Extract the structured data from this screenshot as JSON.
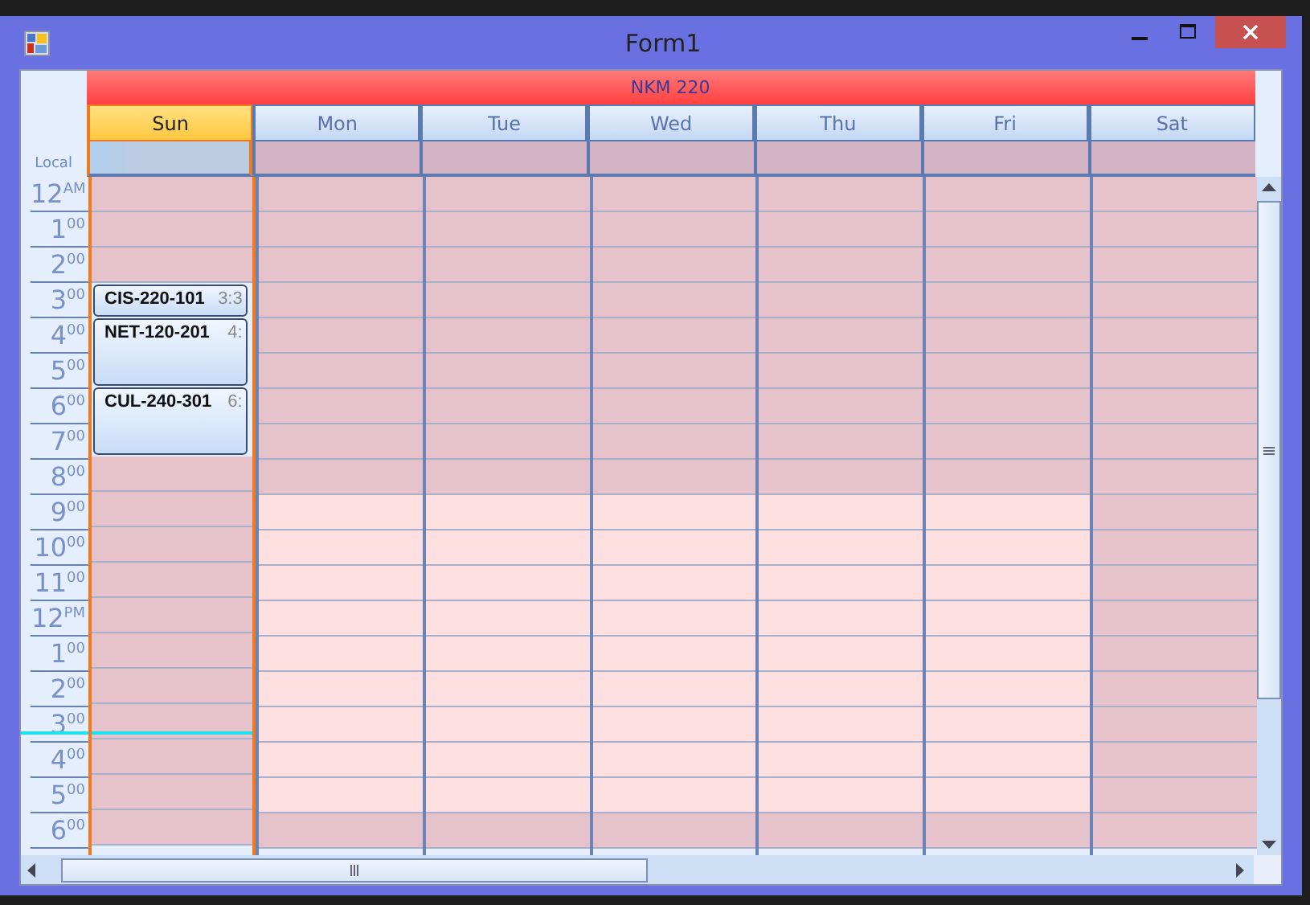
{
  "window": {
    "title": "Form1"
  },
  "resource": {
    "name": "NKM 220"
  },
  "time_column": {
    "label": "Local"
  },
  "days": [
    {
      "label": "Sun",
      "selected": true,
      "workday": false,
      "today": true,
      "events": [
        {
          "kind": "free"
        },
        {
          "kind": "free"
        },
        {
          "kind": "free"
        },
        {
          "kind": "appointment",
          "title": "CIS-220-101",
          "time": "3:3",
          "long": false
        },
        {
          "kind": "appointment",
          "title": "NET-120-201",
          "time": "4:",
          "long": true
        },
        {
          "kind": "appointment",
          "title": "CUL-240-301",
          "time": "6:",
          "long": true
        },
        {
          "kind": "free"
        },
        {
          "kind": "free"
        },
        {
          "kind": "free"
        },
        {
          "kind": "free"
        },
        {
          "kind": "free"
        },
        {
          "kind": "free"
        },
        {
          "kind": "free"
        },
        {
          "kind": "free"
        },
        {
          "kind": "free"
        },
        {
          "kind": "free"
        },
        {
          "kind": "free"
        }
      ]
    },
    {
      "label": "Mon",
      "selected": false,
      "workday": true,
      "today": false
    },
    {
      "label": "Tue",
      "selected": false,
      "workday": true,
      "today": false
    },
    {
      "label": "Wed",
      "selected": false,
      "workday": true,
      "today": false
    },
    {
      "label": "Thu",
      "selected": false,
      "workday": true,
      "today": false
    },
    {
      "label": "Fri",
      "selected": false,
      "workday": true,
      "today": false
    },
    {
      "label": "Sat",
      "selected": false,
      "workday": false,
      "today": false
    }
  ],
  "hours": [
    {
      "label": "12$^{AM}$",
      "work": false,
      "now": false
    },
    {
      "label": "1$^{00}$",
      "work": false,
      "now": false
    },
    {
      "label": "2$^{00}$",
      "work": false,
      "now": false
    },
    {
      "label": "3$^{00}$",
      "work": false,
      "now": false
    },
    {
      "label": "4$^{00}$",
      "work": false,
      "now": false
    },
    {
      "label": "5$^{00}$",
      "work": false,
      "now": false
    },
    {
      "label": "6$^{00}$",
      "work": false,
      "now": false
    },
    {
      "label": "7$^{00}$",
      "work": false,
      "now": false
    },
    {
      "label": "8$^{00}$",
      "work": false,
      "now": false
    },
    {
      "label": "9$^{00}$",
      "work": true,
      "now": false
    },
    {
      "label": "10$^{00}$",
      "work": true,
      "now": false
    },
    {
      "label": "11$^{00}$",
      "work": true,
      "now": false
    },
    {
      "label": "12$^{PM}$",
      "work": true,
      "now": false
    },
    {
      "label": "1$^{00}$",
      "work": true,
      "now": false
    },
    {
      "label": "2$^{00}$",
      "work": true,
      "now": false
    },
    {
      "label": "3$^{00}$",
      "work": true,
      "now": true
    },
    {
      "label": "4$^{00}$",
      "work": true,
      "now": false
    },
    {
      "label": "5$^{00}$",
      "work": true,
      "now": false
    },
    {
      "label": "6$^{00}$",
      "work": false,
      "now": false
    }
  ]
}
